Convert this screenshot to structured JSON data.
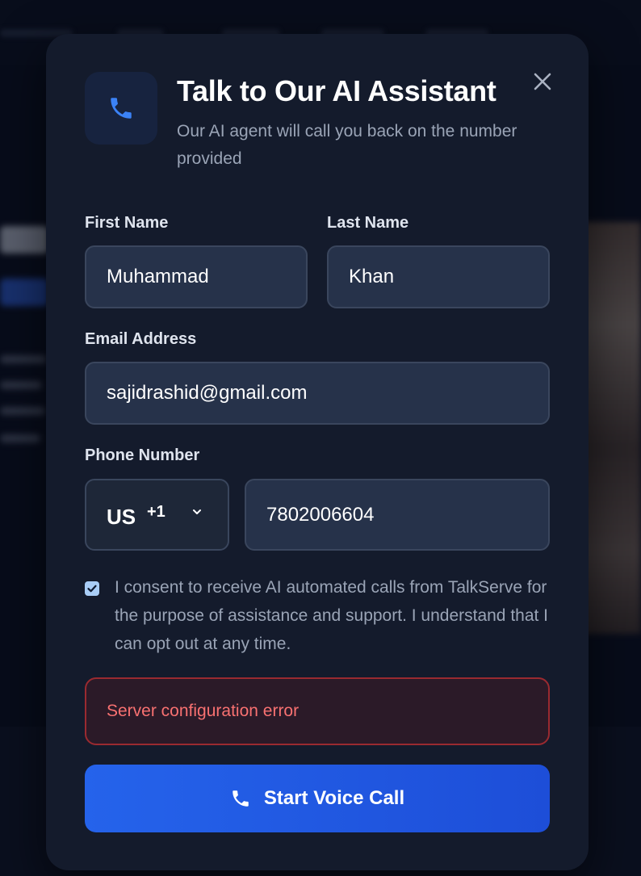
{
  "modal": {
    "title": "Talk to Our AI Assistant",
    "subtitle": "Our AI agent will call you back on the number provided",
    "icon": "phone-icon",
    "close_icon": "close-icon"
  },
  "form": {
    "first_name": {
      "label": "First Name",
      "value": "Muhammad"
    },
    "last_name": {
      "label": "Last Name",
      "value": "Khan"
    },
    "email": {
      "label": "Email Address",
      "value": "sajidrashid@gmail.com"
    },
    "phone": {
      "label": "Phone Number",
      "country": "US",
      "dial_code": "+1",
      "value": "7802006604"
    },
    "consent": {
      "checked": true,
      "text": "I consent to receive AI automated calls from TalkServe for the purpose of assistance and support. I understand that I can opt out at any time."
    }
  },
  "error": {
    "message": "Server configuration error"
  },
  "cta": {
    "label": "Start Voice Call",
    "icon": "phone-icon"
  },
  "colors": {
    "accent": "#2563eb",
    "modal_bg": "#141b2c",
    "input_bg": "#26324a",
    "error_text": "#f87171",
    "error_border": "#9a2a30"
  }
}
